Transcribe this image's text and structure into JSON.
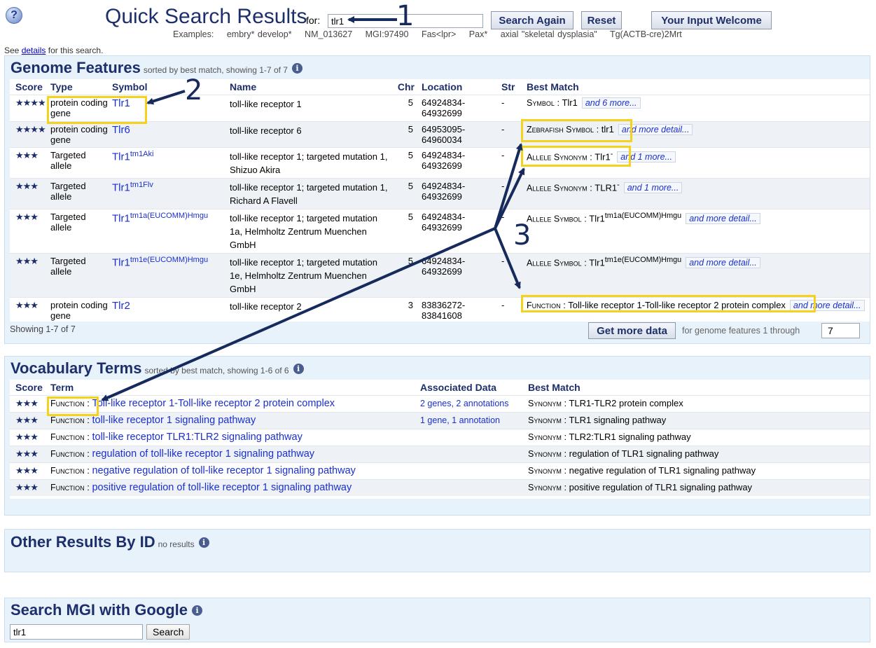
{
  "header": {
    "help_icon": "?",
    "title": "Quick Search Results",
    "for_label": "for:",
    "query": "tlr1",
    "buttons": {
      "search_again": "Search Again",
      "reset": "Reset",
      "input_welcome": "Your Input Welcome"
    },
    "examples": [
      "Examples:",
      "embry* develop*",
      "NM_013627",
      "MGI:97490",
      "Fas<lpr>",
      "Pax*",
      "axial \"skeletal dysplasia\"",
      "Tg(ACTB-cre)2Mrt"
    ],
    "see_details": {
      "prefix": "See",
      "link": "details",
      "suffix": "for this search."
    }
  },
  "genome": {
    "title": "Genome Features",
    "subtitle": "sorted by best match, showing 1-7 of 7",
    "columns": [
      "Score",
      "Type",
      "Symbol",
      "Name",
      "Chr",
      "Location",
      "Str",
      "Best Match"
    ],
    "rows": [
      {
        "stars": "★★★★",
        "type": "protein coding gene",
        "symbol": "Tlr1",
        "sup": "",
        "name": "toll-like receptor 1",
        "chr": "5",
        "loc1": "64924834-",
        "loc2": "64932699",
        "str": "-",
        "bm_label": "Symbol",
        "bm_value": " : Tlr1",
        "more": "and 6 more..."
      },
      {
        "stars": "★★★★",
        "type": "protein coding gene",
        "symbol": "Tlr6",
        "sup": "",
        "name": "toll-like receptor 6",
        "chr": "5",
        "loc1": "64953095-",
        "loc2": "64960034",
        "str": "-",
        "bm_label": "Zebrafish Symbol",
        "bm_value": " : tlr1",
        "more": "and more detail..."
      },
      {
        "stars": "★★★",
        "type": "Targeted allele",
        "symbol": "Tlr1",
        "sup": "tm1Aki",
        "name": "toll-like receptor 1; targeted mutation 1, Shizuo Akira",
        "chr": "5",
        "loc1": "64924834-",
        "loc2": "64932699",
        "str": "-",
        "bm_label": "Allele Synonym",
        "bm_value": " : Tlr1",
        "bm_sup": "-",
        "more": "and 1 more..."
      },
      {
        "stars": "★★★",
        "type": "Targeted allele",
        "symbol": "Tlr1",
        "sup": "tm1Flv",
        "name": "toll-like receptor 1; targeted mutation 1, Richard A Flavell",
        "chr": "5",
        "loc1": "64924834-",
        "loc2": "64932699",
        "str": "-",
        "bm_label": "Allele Synonym",
        "bm_value": " : TLR1",
        "bm_sup": "-",
        "more": "and 1 more..."
      },
      {
        "stars": "★★★",
        "type": "Targeted allele",
        "symbol": "Tlr1",
        "sup": "tm1a(EUCOMM)Hmgu",
        "name": "toll-like receptor 1; targeted mutation 1a, Helmholtz Zentrum Muenchen GmbH",
        "chr": "5",
        "loc1": "64924834-",
        "loc2": "64932699",
        "str": "-",
        "bm_label": "Allele Symbol",
        "bm_value": " : Tlr1",
        "bm_sup": "tm1a(EUCOMM)Hmgu",
        "more": "and more detail..."
      },
      {
        "stars": "★★★",
        "type": "Targeted allele",
        "symbol": "Tlr1",
        "sup": "tm1e(EUCOMM)Hmgu",
        "name": "toll-like receptor 1; targeted mutation 1e, Helmholtz Zentrum Muenchen GmbH",
        "chr": "5",
        "loc1": "64924834-",
        "loc2": "64932699",
        "str": "-",
        "bm_label": "Allele Symbol",
        "bm_value": " : Tlr1",
        "bm_sup": "tm1e(EUCOMM)Hmgu",
        "more": "and more detail..."
      },
      {
        "stars": "★★★",
        "type": "protein coding gene",
        "symbol": "Tlr2",
        "sup": "",
        "name": "toll-like receptor 2",
        "chr": "3",
        "loc1": "83836272-",
        "loc2": "83841608",
        "str": "-",
        "bm_label": "Function",
        "bm_value": " : Toll-like receptor 1-Toll-like receptor 2 protein complex",
        "more": "and more detail..."
      }
    ],
    "showing": "Showing 1-7 of 7",
    "get_more": {
      "button": "Get more data",
      "label": "for genome features 1 through",
      "value": "7"
    }
  },
  "vocab": {
    "title": "Vocabulary Terms",
    "subtitle": "sorted by best match, showing 1-6 of 6",
    "columns": [
      "Score",
      "Term",
      "Associated Data",
      "Best Match"
    ],
    "rows": [
      {
        "stars": "★★★",
        "label": "Function",
        "term": "Toll-like receptor 1-Toll-like receptor 2 protein complex",
        "assoc": "2 genes, 2 annotations",
        "bm_label": "Synonym",
        "bm_value": " : TLR1-TLR2 protein complex"
      },
      {
        "stars": "★★★",
        "label": "Function",
        "term": "toll-like receptor 1 signaling pathway",
        "assoc": "1 gene, 1 annotation",
        "bm_label": "Synonym",
        "bm_value": " : TLR1 signaling pathway"
      },
      {
        "stars": "★★★",
        "label": "Function",
        "term": "toll-like receptor TLR1:TLR2 signaling pathway",
        "assoc": "",
        "bm_label": "Synonym",
        "bm_value": " : TLR2:TLR1 signaling pathway"
      },
      {
        "stars": "★★★",
        "label": "Function",
        "term": "regulation of toll-like receptor 1 signaling pathway",
        "assoc": "",
        "bm_label": "Synonym",
        "bm_value": " : regulation of TLR1 signaling pathway"
      },
      {
        "stars": "★★★",
        "label": "Function",
        "term": "negative regulation of toll-like receptor 1 signaling pathway",
        "assoc": "",
        "bm_label": "Synonym",
        "bm_value": " : negative regulation of TLR1 signaling pathway"
      },
      {
        "stars": "★★★",
        "label": "Function",
        "term": "positive regulation of toll-like receptor 1 signaling pathway",
        "assoc": "",
        "bm_label": "Synonym",
        "bm_value": " : positive regulation of TLR1 signaling pathway"
      }
    ]
  },
  "other_ids": {
    "title": "Other Results By ID",
    "subtitle": "no results"
  },
  "google": {
    "title": "Search MGI with Google",
    "query": "tlr1",
    "button": "Search"
  },
  "info_icon": "i",
  "annotations": {
    "n1": "1",
    "n2": "2",
    "n3": "3"
  },
  "colors": {
    "title": "#1c2f6b",
    "link": "#1a2fd0",
    "panel": "#e8f2fb",
    "highlight": "#f5d21e",
    "arrow": "#162a5c"
  }
}
